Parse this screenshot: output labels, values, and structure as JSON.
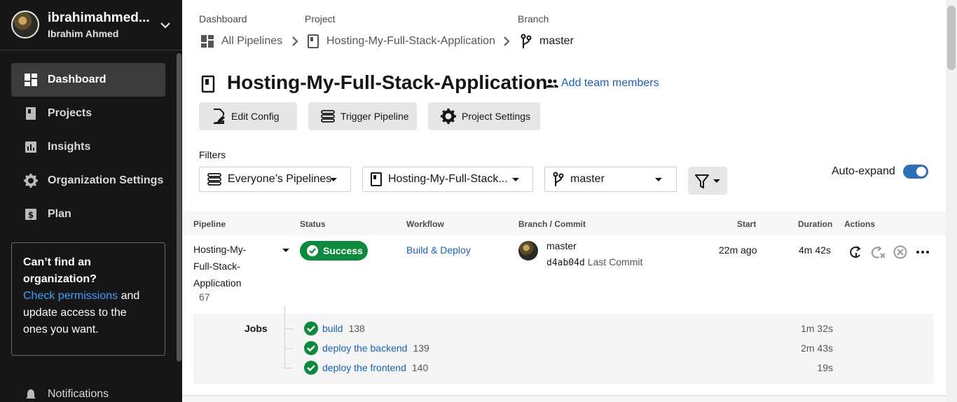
{
  "sidebar": {
    "user": {
      "login": "ibrahimahmed...",
      "name": "Ibrahim Ahmed"
    },
    "items": [
      {
        "label": "Dashboard",
        "icon": "dashboard-icon",
        "active": true
      },
      {
        "label": "Projects",
        "icon": "projects-icon"
      },
      {
        "label": "Insights",
        "icon": "insights-icon"
      },
      {
        "label": "Organization Settings",
        "icon": "gear-icon"
      },
      {
        "label": "Plan",
        "icon": "dollar-icon"
      }
    ],
    "org_box": {
      "title": "Can’t find an organization?",
      "link": "Check permissions",
      "rest": " and update access to the ones you want."
    },
    "notifications": "Notifications"
  },
  "breadcrumb": {
    "labels": [
      "Dashboard",
      "Project",
      "Branch"
    ],
    "items": [
      "All Pipelines",
      "Hosting-My-Full-Stack-Application",
      "master"
    ]
  },
  "header": {
    "title": "Hosting-My-Full-Stack-Application",
    "add_team": "Add team members",
    "buttons": [
      "Edit Config",
      "Trigger Pipeline",
      "Project Settings"
    ]
  },
  "filters": {
    "label": "Filters",
    "pipelines": "Everyone’s Pipelines",
    "project": "Hosting-My-Full-Stack...",
    "branch": "master",
    "auto_expand": "Auto-expand",
    "auto_expand_on": true
  },
  "table": {
    "headers": [
      "Pipeline",
      "Status",
      "Workflow",
      "Branch / Commit",
      "Start",
      "Duration",
      "Actions"
    ],
    "row": {
      "pipeline_lines": [
        "Hosting-My-",
        "Full-Stack-",
        "Application"
      ],
      "number": "67",
      "status": "Success",
      "workflow": "Build & Deploy",
      "branch": "master",
      "commit_hash": "d4ab04d",
      "commit_label": "Last Commit",
      "start": "22m ago",
      "duration": "4m 42s"
    },
    "jobs_label": "Jobs",
    "jobs": [
      {
        "name": "build",
        "number": "138",
        "duration": "1m 32s"
      },
      {
        "name": "deploy the backend",
        "number": "139",
        "duration": "2m 43s"
      },
      {
        "name": "deploy the frontend",
        "number": "140",
        "duration": "19s"
      }
    ]
  },
  "colors": {
    "success": "#0d8a3e",
    "link": "#1a5fb4",
    "sidebar_bg": "#161616",
    "toggle": "#2c6fb7"
  }
}
